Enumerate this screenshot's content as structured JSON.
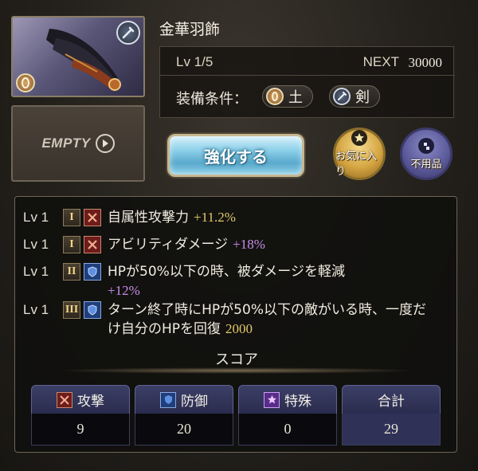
{
  "item": {
    "name": "金華羽飾",
    "element_icon": "earth-element-icon",
    "weapon_icon": "sword-icon"
  },
  "empty_slot": {
    "label": "EMPTY"
  },
  "level": {
    "label": "Lv 1/5",
    "next_label": "NEXT",
    "next_value": "30000"
  },
  "equip": {
    "label": "装備条件：",
    "conditions": [
      {
        "icon": "earth-element-icon",
        "text": "土"
      },
      {
        "icon": "sword-icon",
        "text": "剣"
      }
    ]
  },
  "buttons": {
    "upgrade": "強化する",
    "favorite": "お気に入り",
    "junk": "不用品"
  },
  "skills": [
    {
      "lv": "Lv 1",
      "rank": "I",
      "type": "attack",
      "text": "自属性攻撃力",
      "value": "+11.2%",
      "value_color": "gold"
    },
    {
      "lv": "Lv 1",
      "rank": "I",
      "type": "attack",
      "text": "アビリティダメージ",
      "value": "+18%",
      "value_color": "purple"
    },
    {
      "lv": "Lv 1",
      "rank": "II",
      "type": "defense",
      "text": "HPが50%以下の時、被ダメージを軽減",
      "value": "+12%",
      "value_color": "purple"
    },
    {
      "lv": "Lv 1",
      "rank": "III",
      "type": "defense",
      "text": "ターン終了時にHPが50%以下の敵がいる時、一度だけ自分のHPを回復",
      "value": "2000",
      "value_color": "gold"
    }
  ],
  "score": {
    "title": "スコア",
    "columns": [
      {
        "label": "攻撃",
        "value": "9",
        "icon": "attack-icon"
      },
      {
        "label": "防御",
        "value": "20",
        "icon": "shield-icon"
      },
      {
        "label": "特殊",
        "value": "0",
        "icon": "star-icon"
      },
      {
        "label": "合計",
        "value": "29",
        "icon": ""
      }
    ]
  },
  "colors": {
    "gold_value": "#e0c96a",
    "purple_value": "#c98de8",
    "upgrade_button": "#8fd1ea"
  }
}
